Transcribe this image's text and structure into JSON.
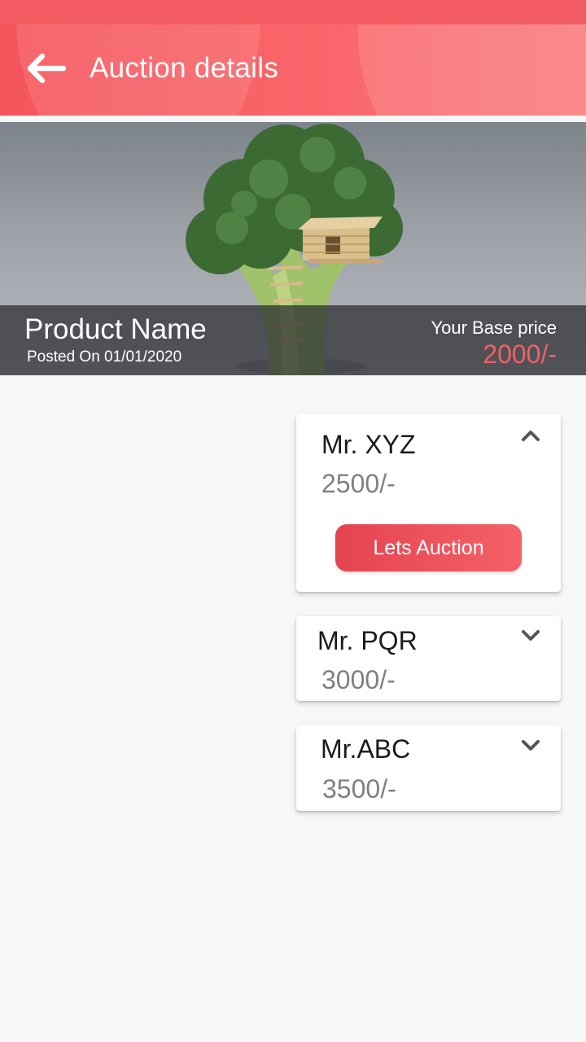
{
  "app_bar": {
    "title": "Auction details",
    "back_icon": "arrow-left-icon",
    "color": "#f4555c"
  },
  "product": {
    "name": "Product Name",
    "posted_on": "Posted On 01/01/2020",
    "base_price_label": "Your Base price",
    "base_price": "2000/-",
    "price_color": "#f26064"
  },
  "bids": [
    {
      "name": "Mr. XYZ",
      "amount": "2500/-",
      "expanded": true,
      "action_label": "Lets Auction",
      "chevron": "chevron-up-icon"
    },
    {
      "name": "Mr. PQR",
      "amount": "3000/-",
      "expanded": false,
      "chevron": "chevron-down-icon"
    },
    {
      "name": "Mr.ABC",
      "amount": "3500/-",
      "expanded": false,
      "chevron": "chevron-down-icon"
    }
  ]
}
